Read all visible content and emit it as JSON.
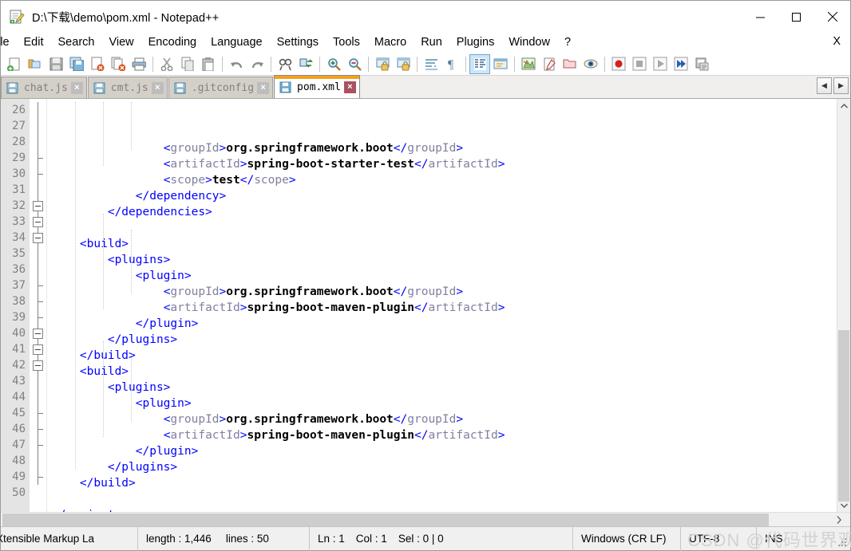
{
  "window": {
    "title": "D:\\下载\\demo\\pom.xml - Notepad++",
    "icon": "notepad-plus-plus-icon",
    "controls": {
      "minimize": "—",
      "maximize": "☐",
      "close": "×"
    }
  },
  "menu": {
    "items": [
      {
        "label": "ile"
      },
      {
        "label": "Edit"
      },
      {
        "label": "Search"
      },
      {
        "label": "View"
      },
      {
        "label": "Encoding"
      },
      {
        "label": "Language"
      },
      {
        "label": "Settings"
      },
      {
        "label": "Tools"
      },
      {
        "label": "Macro"
      },
      {
        "label": "Run"
      },
      {
        "label": "Plugins"
      },
      {
        "label": "Window"
      },
      {
        "label": "?"
      }
    ],
    "close_document": "X"
  },
  "toolbar": {
    "buttons": [
      {
        "name": "new-file-icon",
        "tooltip": "New"
      },
      {
        "name": "open-file-icon",
        "tooltip": "Open"
      },
      {
        "name": "save-icon",
        "tooltip": "Save"
      },
      {
        "name": "save-all-icon",
        "tooltip": "Save All"
      },
      {
        "name": "close-file-icon",
        "tooltip": "Close"
      },
      {
        "name": "close-all-icon",
        "tooltip": "Close All"
      },
      {
        "name": "print-icon",
        "tooltip": "Print"
      },
      {
        "name": "cut-icon",
        "tooltip": "Cut"
      },
      {
        "name": "copy-icon",
        "tooltip": "Copy"
      },
      {
        "name": "paste-icon",
        "tooltip": "Paste"
      },
      {
        "name": "undo-icon",
        "tooltip": "Undo"
      },
      {
        "name": "redo-icon",
        "tooltip": "Redo"
      },
      {
        "name": "find-icon",
        "tooltip": "Find"
      },
      {
        "name": "replace-icon",
        "tooltip": "Replace"
      },
      {
        "name": "zoom-in-icon",
        "tooltip": "Zoom In"
      },
      {
        "name": "zoom-out-icon",
        "tooltip": "Zoom Out"
      },
      {
        "name": "sync-vertical-icon",
        "tooltip": "Synchronize Vertical Scrolling"
      },
      {
        "name": "sync-horizontal-icon",
        "tooltip": "Synchronize Horizontal Scrolling"
      },
      {
        "name": "word-wrap-icon",
        "tooltip": "Word wrap"
      },
      {
        "name": "show-all-chars-icon",
        "tooltip": "Show All Characters"
      },
      {
        "name": "indent-guide-icon",
        "tooltip": "Show Indent Guide"
      },
      {
        "name": "user-defined-dialog-icon",
        "tooltip": "User-Defined Dialogue"
      },
      {
        "name": "document-map-icon",
        "tooltip": "Document Map"
      },
      {
        "name": "function-list-icon",
        "tooltip": "Function List"
      },
      {
        "name": "folder-workspace-icon",
        "tooltip": "Folder as Workspace"
      },
      {
        "name": "monitoring-icon",
        "tooltip": "Monitoring"
      },
      {
        "name": "macro-record-icon",
        "tooltip": "Start Recording"
      },
      {
        "name": "macro-stop-icon",
        "tooltip": "Stop Recording"
      },
      {
        "name": "macro-play-icon",
        "tooltip": "Playback"
      },
      {
        "name": "macro-run-multiple-icon",
        "tooltip": "Run a Macro Multiple Times"
      },
      {
        "name": "macro-save-icon",
        "tooltip": "Save Current Recorded Macro"
      }
    ]
  },
  "tabs": {
    "items": [
      {
        "label": "chat.js",
        "active": false
      },
      {
        "label": "cmt.js",
        "active": false
      },
      {
        "label": ".gitconfig",
        "active": false
      },
      {
        "label": "pom.xml",
        "active": true
      }
    ],
    "close_glyph": "×",
    "scroll_left": "◀",
    "scroll_right": "▶"
  },
  "editor": {
    "first_line": 26,
    "lines": [
      {
        "n": 26,
        "indent": 4,
        "fold": "none",
        "parts": [
          {
            "t": "<",
            "c": "tagb"
          },
          {
            "t": "groupId",
            "c": "tagn"
          },
          {
            "t": ">",
            "c": "tagb"
          },
          {
            "t": "org.springframework.boot",
            "c": "txt"
          },
          {
            "t": "</",
            "c": "tagb"
          },
          {
            "t": "groupId",
            "c": "tagn"
          },
          {
            "t": ">",
            "c": "tagb"
          }
        ]
      },
      {
        "n": 27,
        "indent": 4,
        "fold": "none",
        "parts": [
          {
            "t": "<",
            "c": "tagb"
          },
          {
            "t": "artifactId",
            "c": "tagn"
          },
          {
            "t": ">",
            "c": "tagb"
          },
          {
            "t": "spring-boot-starter-test",
            "c": "txt"
          },
          {
            "t": "</",
            "c": "tagb"
          },
          {
            "t": "artifactId",
            "c": "tagn"
          },
          {
            "t": ">",
            "c": "tagb"
          }
        ]
      },
      {
        "n": 28,
        "indent": 4,
        "fold": "none",
        "parts": [
          {
            "t": "<",
            "c": "tagb"
          },
          {
            "t": "scope",
            "c": "tagn"
          },
          {
            "t": ">",
            "c": "tagb"
          },
          {
            "t": "test",
            "c": "txt"
          },
          {
            "t": "</",
            "c": "tagb"
          },
          {
            "t": "scope",
            "c": "tagn"
          },
          {
            "t": ">",
            "c": "tagb"
          }
        ]
      },
      {
        "n": 29,
        "indent": 3,
        "fold": "end",
        "parts": [
          {
            "t": "</dependency>",
            "c": "tagb"
          }
        ]
      },
      {
        "n": 30,
        "indent": 2,
        "fold": "end",
        "parts": [
          {
            "t": "</dependencies>",
            "c": "tagb"
          }
        ]
      },
      {
        "n": 31,
        "indent": 0,
        "fold": "none",
        "parts": []
      },
      {
        "n": 32,
        "indent": 1,
        "fold": "open",
        "parts": [
          {
            "t": "<build>",
            "c": "tagb"
          }
        ]
      },
      {
        "n": 33,
        "indent": 2,
        "fold": "open",
        "parts": [
          {
            "t": "<plugins>",
            "c": "tagb"
          }
        ]
      },
      {
        "n": 34,
        "indent": 3,
        "fold": "open",
        "parts": [
          {
            "t": "<plugin>",
            "c": "tagb"
          }
        ]
      },
      {
        "n": 35,
        "indent": 4,
        "fold": "none",
        "parts": [
          {
            "t": "<",
            "c": "tagb"
          },
          {
            "t": "groupId",
            "c": "tagn"
          },
          {
            "t": ">",
            "c": "tagb"
          },
          {
            "t": "org.springframework.boot",
            "c": "txt"
          },
          {
            "t": "</",
            "c": "tagb"
          },
          {
            "t": "groupId",
            "c": "tagn"
          },
          {
            "t": ">",
            "c": "tagb"
          }
        ]
      },
      {
        "n": 36,
        "indent": 4,
        "fold": "none",
        "parts": [
          {
            "t": "<",
            "c": "tagb"
          },
          {
            "t": "artifactId",
            "c": "tagn"
          },
          {
            "t": ">",
            "c": "tagb"
          },
          {
            "t": "spring-boot-maven-plugin",
            "c": "txt"
          },
          {
            "t": "</",
            "c": "tagb"
          },
          {
            "t": "artifactId",
            "c": "tagn"
          },
          {
            "t": ">",
            "c": "tagb"
          }
        ]
      },
      {
        "n": 37,
        "indent": 3,
        "fold": "end",
        "parts": [
          {
            "t": "</plugin>",
            "c": "tagb"
          }
        ]
      },
      {
        "n": 38,
        "indent": 2,
        "fold": "end",
        "parts": [
          {
            "t": "</plugins>",
            "c": "tagb"
          }
        ]
      },
      {
        "n": 39,
        "indent": 1,
        "fold": "end",
        "parts": [
          {
            "t": "</build>",
            "c": "tagb"
          }
        ]
      },
      {
        "n": 40,
        "indent": 1,
        "fold": "open",
        "parts": [
          {
            "t": "<build>",
            "c": "tagb"
          }
        ]
      },
      {
        "n": 41,
        "indent": 2,
        "fold": "open",
        "parts": [
          {
            "t": "<plugins>",
            "c": "tagb"
          }
        ]
      },
      {
        "n": 42,
        "indent": 3,
        "fold": "open",
        "parts": [
          {
            "t": "<plugin>",
            "c": "tagb"
          }
        ]
      },
      {
        "n": 43,
        "indent": 4,
        "fold": "none",
        "parts": [
          {
            "t": "<",
            "c": "tagb"
          },
          {
            "t": "groupId",
            "c": "tagn"
          },
          {
            "t": ">",
            "c": "tagb"
          },
          {
            "t": "org.springframework.boot",
            "c": "txt"
          },
          {
            "t": "</",
            "c": "tagb"
          },
          {
            "t": "groupId",
            "c": "tagn"
          },
          {
            "t": ">",
            "c": "tagb"
          }
        ]
      },
      {
        "n": 44,
        "indent": 4,
        "fold": "none",
        "parts": [
          {
            "t": "<",
            "c": "tagb"
          },
          {
            "t": "artifactId",
            "c": "tagn"
          },
          {
            "t": ">",
            "c": "tagb"
          },
          {
            "t": "spring-boot-maven-plugin",
            "c": "txt"
          },
          {
            "t": "</",
            "c": "tagb"
          },
          {
            "t": "artifactId",
            "c": "tagn"
          },
          {
            "t": ">",
            "c": "tagb"
          }
        ]
      },
      {
        "n": 45,
        "indent": 3,
        "fold": "end",
        "parts": [
          {
            "t": "</plugin>",
            "c": "tagb"
          }
        ]
      },
      {
        "n": 46,
        "indent": 2,
        "fold": "end",
        "parts": [
          {
            "t": "</plugins>",
            "c": "tagb"
          }
        ]
      },
      {
        "n": 47,
        "indent": 1,
        "fold": "end",
        "parts": [
          {
            "t": "</build>",
            "c": "tagb"
          }
        ]
      },
      {
        "n": 48,
        "indent": 0,
        "fold": "none",
        "parts": []
      },
      {
        "n": 49,
        "indent": 0,
        "fold": "endroot",
        "parts": [
          {
            "t": "</project>",
            "c": "tagb"
          }
        ]
      },
      {
        "n": 50,
        "indent": 0,
        "fold": "none",
        "parts": []
      }
    ]
  },
  "statusbar": {
    "language": "Xtensible Markup La",
    "length": "length : 1,446",
    "lines": "lines : 50",
    "ln": "Ln : 1",
    "col": "Col : 1",
    "sel": "Sel : 0 | 0",
    "eol": "Windows (CR LF)",
    "encoding": "UTF-8",
    "insert_mode": "INS",
    "watermark": "CSDN @代码世界观"
  },
  "colors": {
    "tag_bracket": "#0000ff",
    "tag_name": "#8080a0",
    "text_content": "#000000",
    "gutter_bg": "#e4e4e4",
    "line_number": "#808080",
    "active_tab_accent": "#f5a11f",
    "active_tab_close": "#a85260"
  }
}
